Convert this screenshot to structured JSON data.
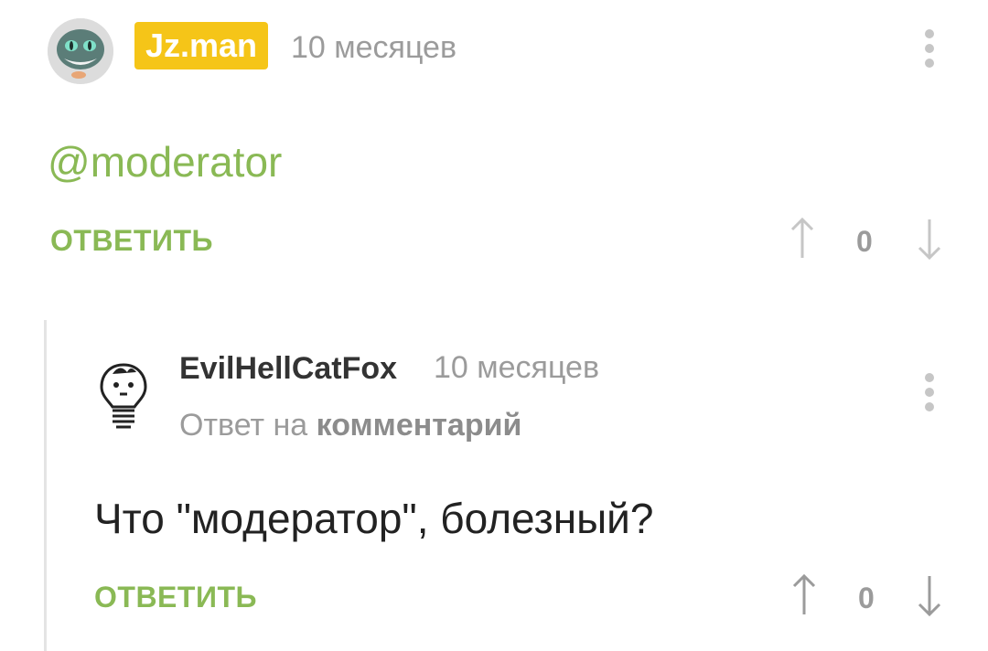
{
  "comments": [
    {
      "author": "Jz.man",
      "time": "10 месяцев",
      "text": "@moderator",
      "reply_label": "ОТВЕТИТЬ",
      "rating": "0",
      "avatar_icon": "cheshire-cat-avatar"
    },
    {
      "author": "EvilHellCatFox",
      "time": "10 месяцев",
      "reply_to_prefix": "Ответ на",
      "reply_to_link": "комментарий",
      "text": "Что \"модератор\", болезный?",
      "reply_label": "ОТВЕТИТЬ",
      "rating": "0",
      "avatar_icon": "lightbulb-face-avatar"
    }
  ],
  "colors": {
    "accent_green": "#8ab955",
    "badge_yellow": "#f5c518",
    "muted_gray": "#9b9b9b"
  }
}
